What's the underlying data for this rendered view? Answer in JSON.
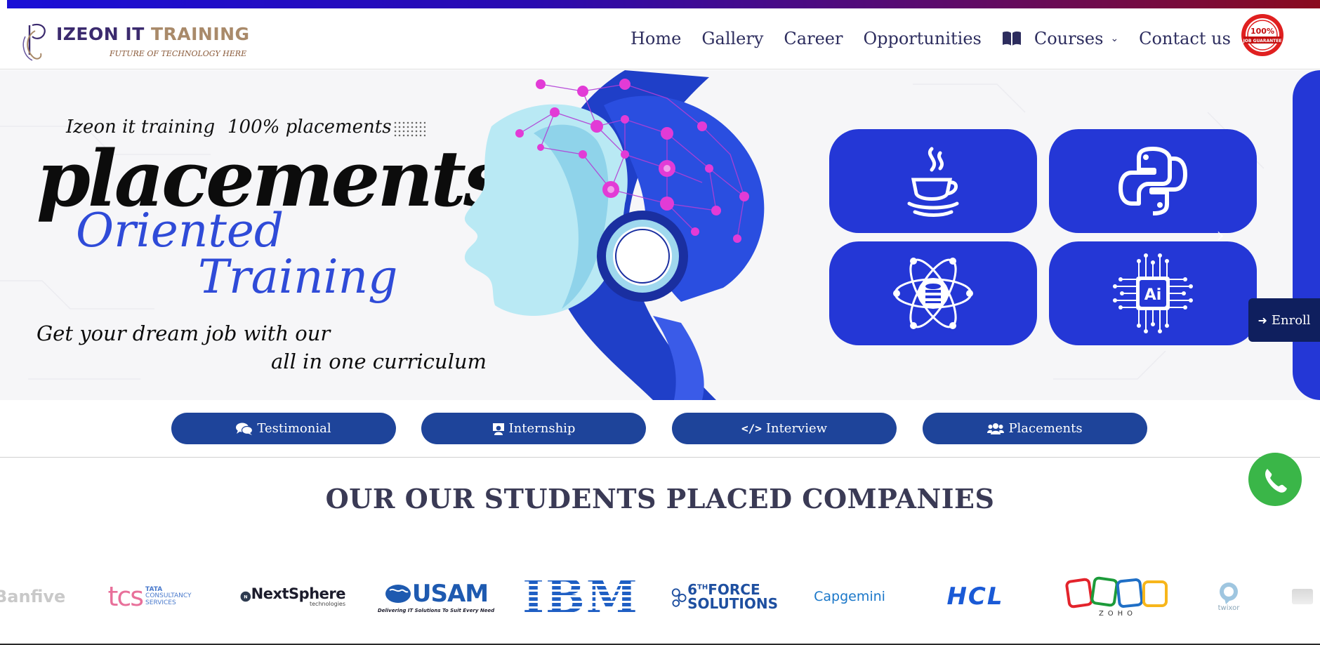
{
  "brand": {
    "name_part1": "IZEON IT ",
    "name_part2": "TRAINING",
    "tagline": "FUTURE OF TECHNOLOGY HERE",
    "badge_text_1": "100%",
    "badge_text_2": "JOB GUARANTEE"
  },
  "nav": {
    "items": [
      {
        "label": "Home"
      },
      {
        "label": "Gallery"
      },
      {
        "label": "Career"
      },
      {
        "label": "Opportunities"
      },
      {
        "label": "Courses",
        "icon": "book-icon",
        "has_dropdown": true
      },
      {
        "label": "Contact us"
      }
    ]
  },
  "hero": {
    "line1": "Izeon it training",
    "line2": "100% placements",
    "headline": "placements",
    "sub1": "Oriented",
    "sub2": "Training",
    "tag1": "Get your dream job with our",
    "tag2": "all in one curriculum",
    "tiles": [
      "java-icon",
      "python-icon",
      "database-icon",
      "ai-chip-icon"
    ],
    "ai_label": "Ai",
    "next_arrow": "›"
  },
  "enroll": {
    "label": "Enroll",
    "icon": "sign-in-icon"
  },
  "quicklinks": [
    {
      "label": "Testimonial",
      "icon": "comments-icon"
    },
    {
      "label": "Internship",
      "icon": "teacher-icon"
    },
    {
      "label": "Interview",
      "icon": "code-icon"
    },
    {
      "label": "Placements",
      "icon": "users-icon"
    }
  ],
  "companies": {
    "title": "OUR OUR STUDENTS PLACED COMPANIES",
    "logos": [
      "Banfive",
      "tcs",
      "TATA",
      "CONSULTANCY",
      "SERVICES",
      "NextSphere",
      "technologies",
      "USAM",
      "Delivering IT Solutions To Suit Every Need",
      "IBM",
      "6",
      "TH",
      "FORCE",
      "SOLUTIONS",
      "Capgemini",
      "HCL",
      "ZOHO",
      "twixor"
    ]
  },
  "colors": {
    "accent": "#1e449a",
    "hero_blue": "#2437d6",
    "nav_text": "#2d2d5e",
    "whatsapp": "#3ab648"
  }
}
